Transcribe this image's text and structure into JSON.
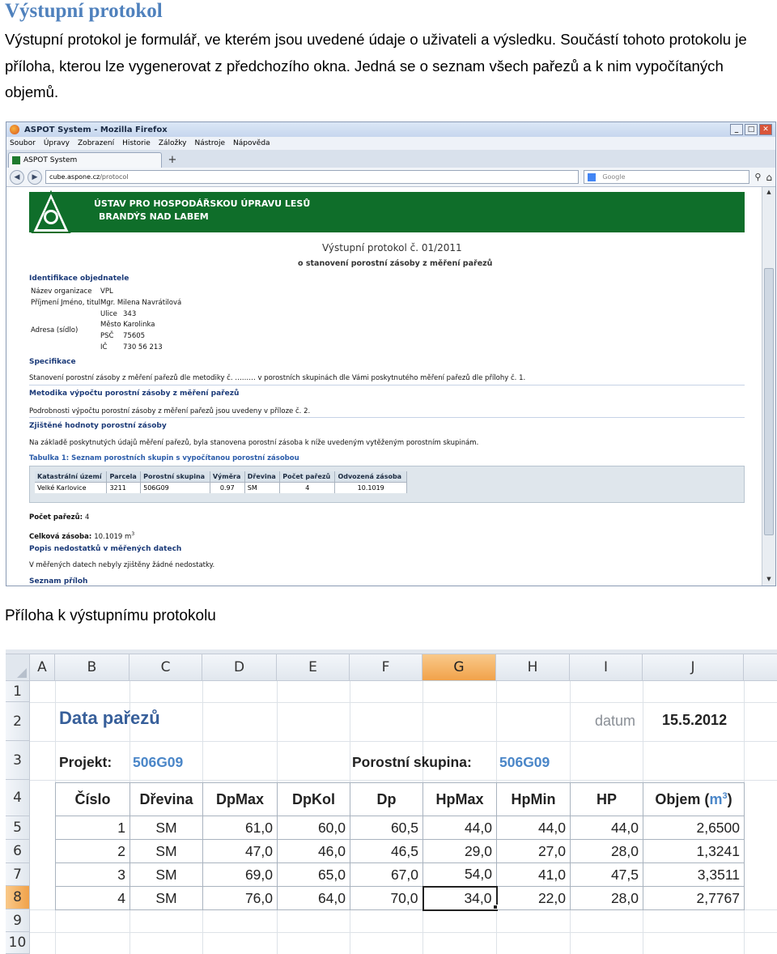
{
  "document": {
    "heading": "Výstupní protokol",
    "paragraph": "Výstupní protokol je formulář, ve kterém jsou uvedené údaje o uživateli a výsledku. Součástí tohoto protokolu je příloha, kterou lze vygenerovat z předchozího okna. Jedná se o seznam všech pařezů a k nim vypočítaných objemů.",
    "caption": "Příloha k výstupnímu protokolu"
  },
  "browser": {
    "window_title": "ASPOT System - Mozilla Firefox",
    "window_buttons": [
      "_",
      "□",
      "✕"
    ],
    "menu": [
      "Soubor",
      "Úpravy",
      "Zobrazení",
      "Historie",
      "Záložky",
      "Nástroje",
      "Nápověda"
    ],
    "tab_label": "ASPOT System",
    "new_tab": "+",
    "url_domain": "cube.aspone.cz",
    "url_path": "/protocol",
    "search_placeholder": "Google",
    "colors": {
      "banner": "#0f6e2a",
      "heading_blue": "#1b3a78"
    }
  },
  "page": {
    "banner_line1": "ÚSTAV PRO HOSPODÁŘSKOU ÚPRAVU LESŮ",
    "banner_line2": "BRANDÝS NAD LABEM",
    "protocol_title": "Výstupní protokol č. 01/2011",
    "protocol_subtitle": "o stanovení porostní zásoby z měření pařezů",
    "ident_heading": "Identifikace objednatele",
    "ident": [
      {
        "label": "Název organizace",
        "value": "VPL"
      },
      {
        "label": "Příjmení Jméno, titul",
        "value": "Mgr. Milena Navrátilová"
      },
      {
        "label": "Ulice",
        "value": "343"
      },
      {
        "label": "Adresa (sídlo)",
        "value": "Město Karolinka"
      },
      {
        "label": "PSČ",
        "value": "75605"
      },
      {
        "label": "IČ",
        "value": "730 56 213"
      }
    ],
    "spec_heading": "Specifikace",
    "spec_text": "Stanovení porostní zásoby z měření pařezů dle metodiky č. ……… v porostních skupinách dle Vámi poskytnutého měření pařezů dle přílohy č. 1.",
    "method_heading": "Metodika výpočtu porostní zásoby z měření pařezů",
    "method_text": "Podrobnosti výpočtu porostní zásoby z měření pařezů jsou uvedeny v příloze č. 2.",
    "found_heading": "Zjištěné hodnoty porostní zásoby",
    "found_text": "Na základě poskytnutých údajů měření pařezů, byla stanovena porostní zásoba k níže uvedeným vytěženým porostním skupinám.",
    "table_caption": "Tabulka 1: Seznam porostních skupin s vypočítanou porostní zásobou",
    "table_headers": [
      "Katastrální území",
      "Parcela",
      "Porostní skupina",
      "Výměra",
      "Dřevina",
      "Počet pařezů",
      "Odvozená zásoba"
    ],
    "table_row": [
      "Velké Karlovice",
      "3211",
      "506G09",
      "0.97",
      "SM",
      "4",
      "10.1019"
    ],
    "count_label": "Počet pařezů:",
    "count_value": "4",
    "total_label": "Celková zásoba:",
    "total_value": "10.1019 m",
    "total_unit_sup": "3",
    "defects_heading": "Popis nedostatků v měřených datech",
    "defects_text": "V měřených datech nebyly zjištěny žádné nedostatky.",
    "attachments_heading": "Seznam příloh"
  },
  "excel": {
    "columns": [
      "A",
      "B",
      "C",
      "D",
      "E",
      "F",
      "G",
      "H",
      "I",
      "J"
    ],
    "active_column": "G",
    "rows": [
      "1",
      "2",
      "3",
      "4",
      "5",
      "6",
      "7",
      "8",
      "9",
      "10"
    ],
    "active_row": "8",
    "title": "Data pařezů",
    "datum_label": "datum",
    "datum_value": "15.5.2012",
    "project_label": "Projekt:",
    "project_value": "506G09",
    "group_label": "Porostní skupina:",
    "group_value": "506G09",
    "headers": [
      "Číslo",
      "Dřevina",
      "DpMax",
      "DpKol",
      "Dp",
      "HpMax",
      "HpMin",
      "HP",
      "Objem ("
    ],
    "unit_main": "m",
    "unit_sup": "3",
    "unit_close": ")",
    "data": [
      [
        "1",
        "SM",
        "61,0",
        "60,0",
        "60,5",
        "44,0",
        "44,0",
        "44,0",
        "2,6500"
      ],
      [
        "2",
        "SM",
        "47,0",
        "46,0",
        "46,5",
        "29,0",
        "27,0",
        "28,0",
        "1,3241"
      ],
      [
        "3",
        "SM",
        "69,0",
        "65,0",
        "67,0",
        "54,0",
        "41,0",
        "47,5",
        "3,3511"
      ],
      [
        "4",
        "SM",
        "76,0",
        "64,0",
        "70,0",
        "34,0",
        "22,0",
        "28,0",
        "2,7767"
      ]
    ],
    "colors": {
      "title": "#375f9a",
      "value_blue": "#4a86c8",
      "active_header": "#f1a24a"
    }
  }
}
